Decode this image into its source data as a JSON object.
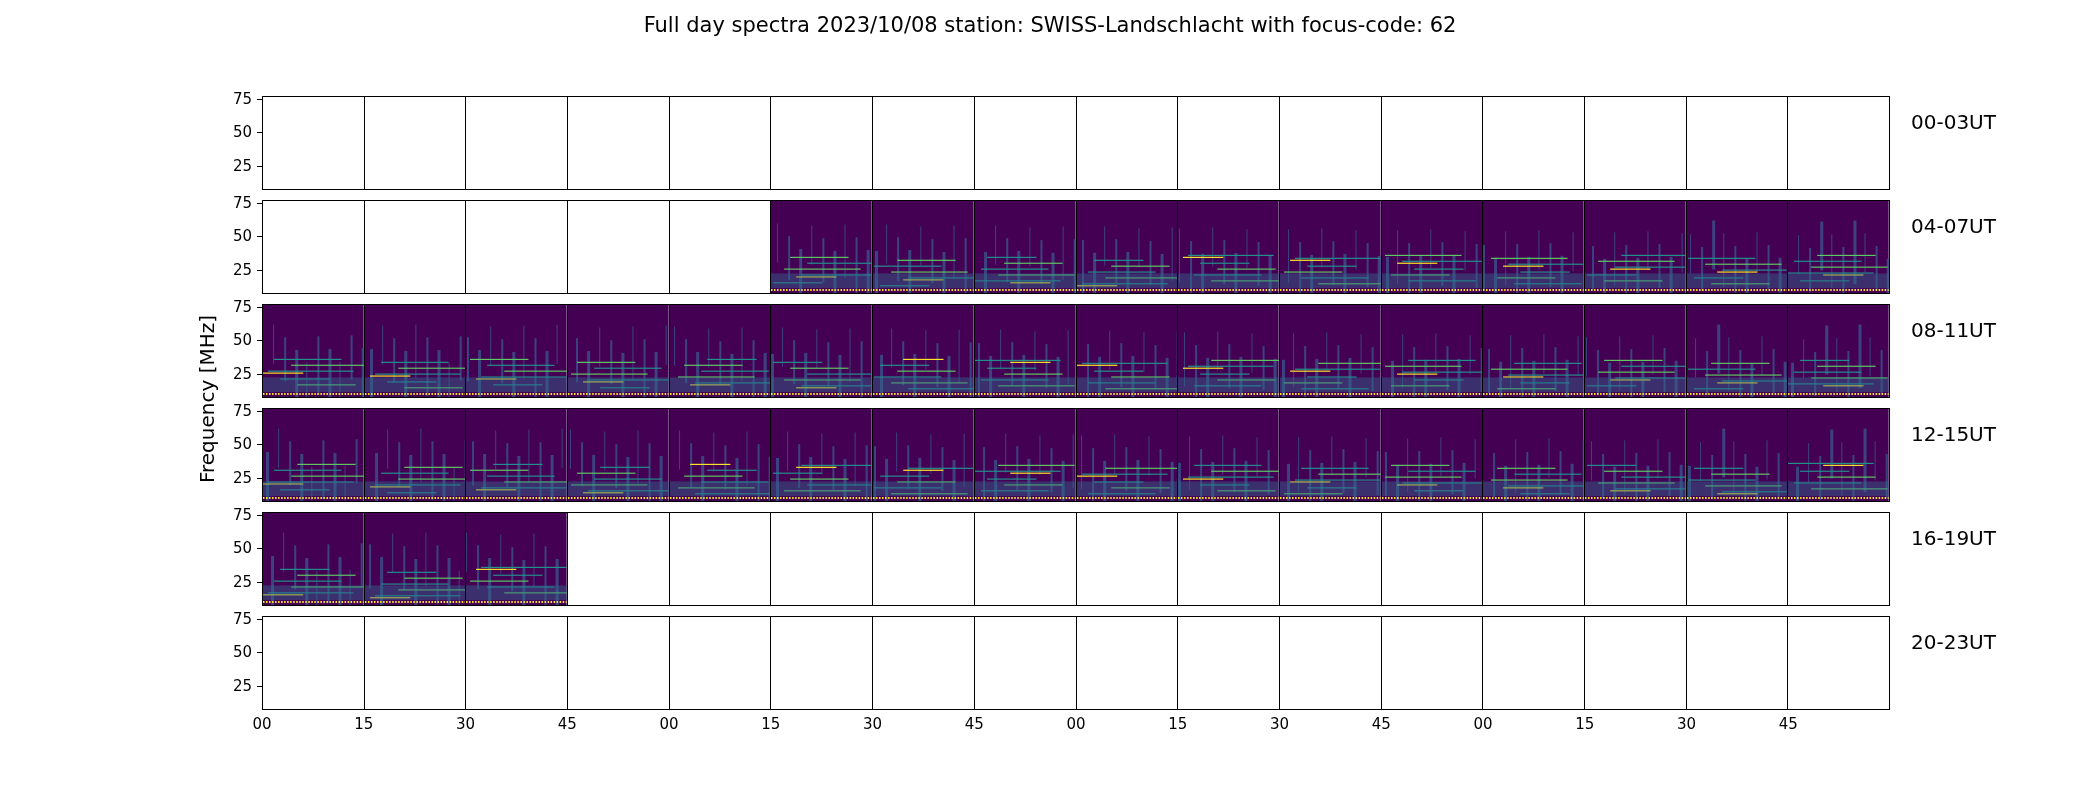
{
  "title": "Full day spectra 2023/10/08 station: SWISS-Landschlacht with focus-code: 62",
  "y_axis_label": "Frequency [MHz]",
  "rows": [
    {
      "label": "00-03UT",
      "yticks": [
        "75",
        "50",
        "25"
      ],
      "panels": [
        {
          "has_data": false
        },
        {
          "has_data": false
        },
        {
          "has_data": false
        },
        {
          "has_data": false
        },
        {
          "has_data": false
        },
        {
          "has_data": false
        },
        {
          "has_data": false
        },
        {
          "has_data": false
        },
        {
          "has_data": false
        },
        {
          "has_data": false
        },
        {
          "has_data": false
        },
        {
          "has_data": false
        },
        {
          "has_data": false
        },
        {
          "has_data": false
        },
        {
          "has_data": false
        },
        {
          "has_data": false
        }
      ]
    },
    {
      "label": "04-07UT",
      "yticks": [
        "75",
        "50",
        "25"
      ],
      "panels": [
        {
          "has_data": false
        },
        {
          "has_data": false
        },
        {
          "has_data": false
        },
        {
          "has_data": false
        },
        {
          "has_data": false
        },
        {
          "has_data": true
        },
        {
          "has_data": true
        },
        {
          "has_data": true
        },
        {
          "has_data": true
        },
        {
          "has_data": true
        },
        {
          "has_data": true
        },
        {
          "has_data": true
        },
        {
          "has_data": true
        },
        {
          "has_data": true
        },
        {
          "has_data": true
        },
        {
          "has_data": true
        }
      ]
    },
    {
      "label": "08-11UT",
      "yticks": [
        "75",
        "50",
        "25"
      ],
      "panels": [
        {
          "has_data": true
        },
        {
          "has_data": true
        },
        {
          "has_data": true
        },
        {
          "has_data": true
        },
        {
          "has_data": true
        },
        {
          "has_data": true
        },
        {
          "has_data": true
        },
        {
          "has_data": true
        },
        {
          "has_data": true
        },
        {
          "has_data": true
        },
        {
          "has_data": true
        },
        {
          "has_data": true
        },
        {
          "has_data": true
        },
        {
          "has_data": true
        },
        {
          "has_data": true
        },
        {
          "has_data": true
        }
      ]
    },
    {
      "label": "12-15UT",
      "yticks": [
        "75",
        "50",
        "25"
      ],
      "panels": [
        {
          "has_data": true
        },
        {
          "has_data": true
        },
        {
          "has_data": true
        },
        {
          "has_data": true
        },
        {
          "has_data": true
        },
        {
          "has_data": true
        },
        {
          "has_data": true
        },
        {
          "has_data": true
        },
        {
          "has_data": true
        },
        {
          "has_data": true
        },
        {
          "has_data": true
        },
        {
          "has_data": true
        },
        {
          "has_data": true
        },
        {
          "has_data": true
        },
        {
          "has_data": true
        },
        {
          "has_data": true
        }
      ]
    },
    {
      "label": "16-19UT",
      "yticks": [
        "75",
        "50",
        "25"
      ],
      "panels": [
        {
          "has_data": true
        },
        {
          "has_data": true
        },
        {
          "has_data": true
        },
        {
          "has_data": false
        },
        {
          "has_data": false
        },
        {
          "has_data": false
        },
        {
          "has_data": false
        },
        {
          "has_data": false
        },
        {
          "has_data": false
        },
        {
          "has_data": false
        },
        {
          "has_data": false
        },
        {
          "has_data": false
        },
        {
          "has_data": false
        },
        {
          "has_data": false
        },
        {
          "has_data": false
        },
        {
          "has_data": false
        }
      ]
    },
    {
      "label": "20-23UT",
      "yticks": [
        "75",
        "50",
        "25"
      ],
      "panels": [
        {
          "has_data": false
        },
        {
          "has_data": false
        },
        {
          "has_data": false
        },
        {
          "has_data": false
        },
        {
          "has_data": false
        },
        {
          "has_data": false
        },
        {
          "has_data": false
        },
        {
          "has_data": false
        },
        {
          "has_data": false
        },
        {
          "has_data": false
        },
        {
          "has_data": false
        },
        {
          "has_data": false
        },
        {
          "has_data": false
        },
        {
          "has_data": false
        },
        {
          "has_data": false
        },
        {
          "has_data": false
        }
      ]
    }
  ],
  "x_tick_labels": [
    "00",
    "15",
    "30",
    "45",
    "00",
    "15",
    "30",
    "45",
    "00",
    "15",
    "30",
    "45",
    "00",
    "15",
    "30",
    "45"
  ]
}
